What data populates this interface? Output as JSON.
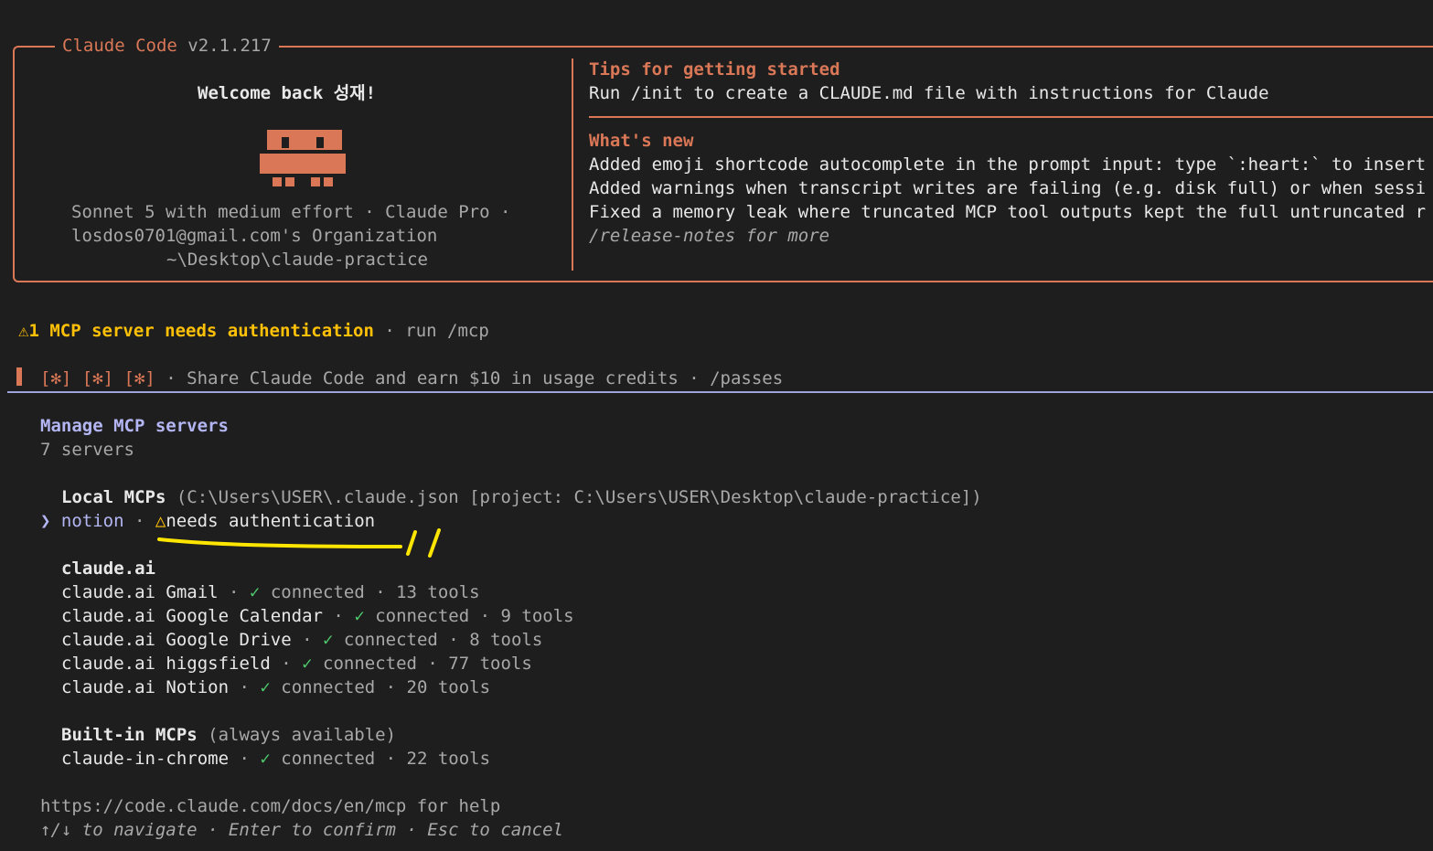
{
  "header": {
    "app_name": "Claude Code",
    "version": "v2.1.217",
    "welcome": "Welcome back 성재!",
    "model_line": "Sonnet 5 with medium effort · Claude Pro ·",
    "org_line": "losdos0701@gmail.com's Organization",
    "path_line": "~\\Desktop\\claude-practice",
    "tips_title": "Tips for getting started",
    "tips_text": "Run /init to create a CLAUDE.md file with instructions for Claude",
    "whats_new_title": "What's new",
    "news": [
      "Added emoji shortcode autocomplete in the prompt input: type `:heart:` to insert",
      "Added warnings when transcript writes are failing (e.g. disk full) or when sessi",
      "Fixed a memory leak where truncated MCP tool outputs kept the full untruncated r"
    ],
    "release_notes": "/release-notes for more"
  },
  "alert": {
    "icon": "warning-icon",
    "text": "1 MCP server needs authentication",
    "hint": " · run /mcp"
  },
  "promo": {
    "badges": "[✻] [✻] [✻]",
    "text": " · Share Claude Code and earn $10 in usage credits · /passes"
  },
  "mcp": {
    "title": "Manage MCP servers",
    "count": "7 servers",
    "local_heading": "Local MCPs",
    "local_path": " (C:\\Users\\USER\\.claude.json [project: C:\\Users\\USER\\Desktop\\claude-practice])",
    "selected_marker": "❯",
    "local_items": [
      {
        "name": "notion",
        "sep": " · ",
        "status_icon": "△",
        "status": "needs authentication"
      }
    ],
    "claude_ai_heading": "claude.ai",
    "claude_ai_items": [
      {
        "name": "claude.ai Gmail",
        "status": "connected",
        "tools": "13 tools"
      },
      {
        "name": "claude.ai Google Calendar",
        "status": "connected",
        "tools": "9 tools"
      },
      {
        "name": "claude.ai Google Drive",
        "status": "connected",
        "tools": "8 tools"
      },
      {
        "name": "claude.ai higgsfield",
        "status": "connected",
        "tools": "77 tools"
      },
      {
        "name": "claude.ai Notion",
        "status": "connected",
        "tools": "20 tools"
      }
    ],
    "builtin_heading": "Built-in MCPs",
    "builtin_note": " (always available)",
    "builtin_items": [
      {
        "name": "claude-in-chrome",
        "status": "connected",
        "tools": "22 tools"
      }
    ],
    "check": "✓",
    "dot": " · "
  },
  "footer": {
    "help": "https://code.claude.com/docs/en/mcp for help",
    "nav": "↑/↓ to navigate · Enter to confirm · Esc to cancel"
  },
  "colors": {
    "accent": "#d97757",
    "warning": "#ffc107",
    "success": "#4ec96c",
    "selection": "#b3b6f3",
    "background": "#1e1e1e"
  }
}
